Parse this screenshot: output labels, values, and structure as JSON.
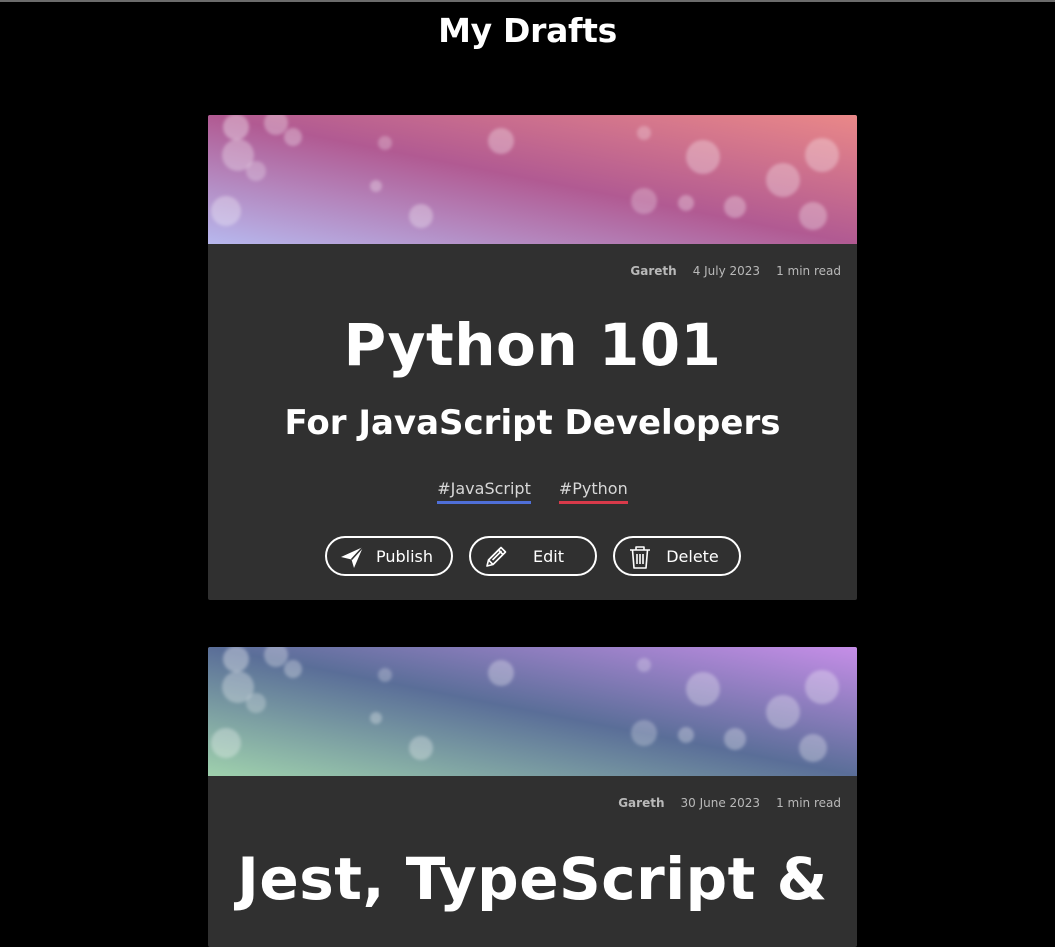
{
  "page": {
    "title": "My Drafts"
  },
  "drafts": [
    {
      "author": "Gareth",
      "date": "4 July 2023",
      "read_time": "1 min read",
      "title": "Python 101",
      "subtitle": "For JavaScript Developers",
      "tags": [
        {
          "label": "#JavaScript",
          "color": "#4f6fd8"
        },
        {
          "label": "#Python",
          "color": "#d93a4a"
        }
      ],
      "banner": {
        "from": "#b7b8ee",
        "mid": "#b15a92",
        "to": "#ea8888"
      }
    },
    {
      "author": "Gareth",
      "date": "30 June 2023",
      "read_time": "1 min read",
      "title": "Jest, TypeScript &",
      "subtitle": "",
      "tags": [],
      "banner": {
        "from": "#9fd1ad",
        "mid": "#5a6e98",
        "to": "#c68ee8"
      }
    }
  ],
  "actions": {
    "publish": "Publish",
    "edit": "Edit",
    "delete": "Delete"
  },
  "icons": {
    "publish": "paper-plane-icon",
    "edit": "pencil-icon",
    "delete": "trash-icon"
  }
}
